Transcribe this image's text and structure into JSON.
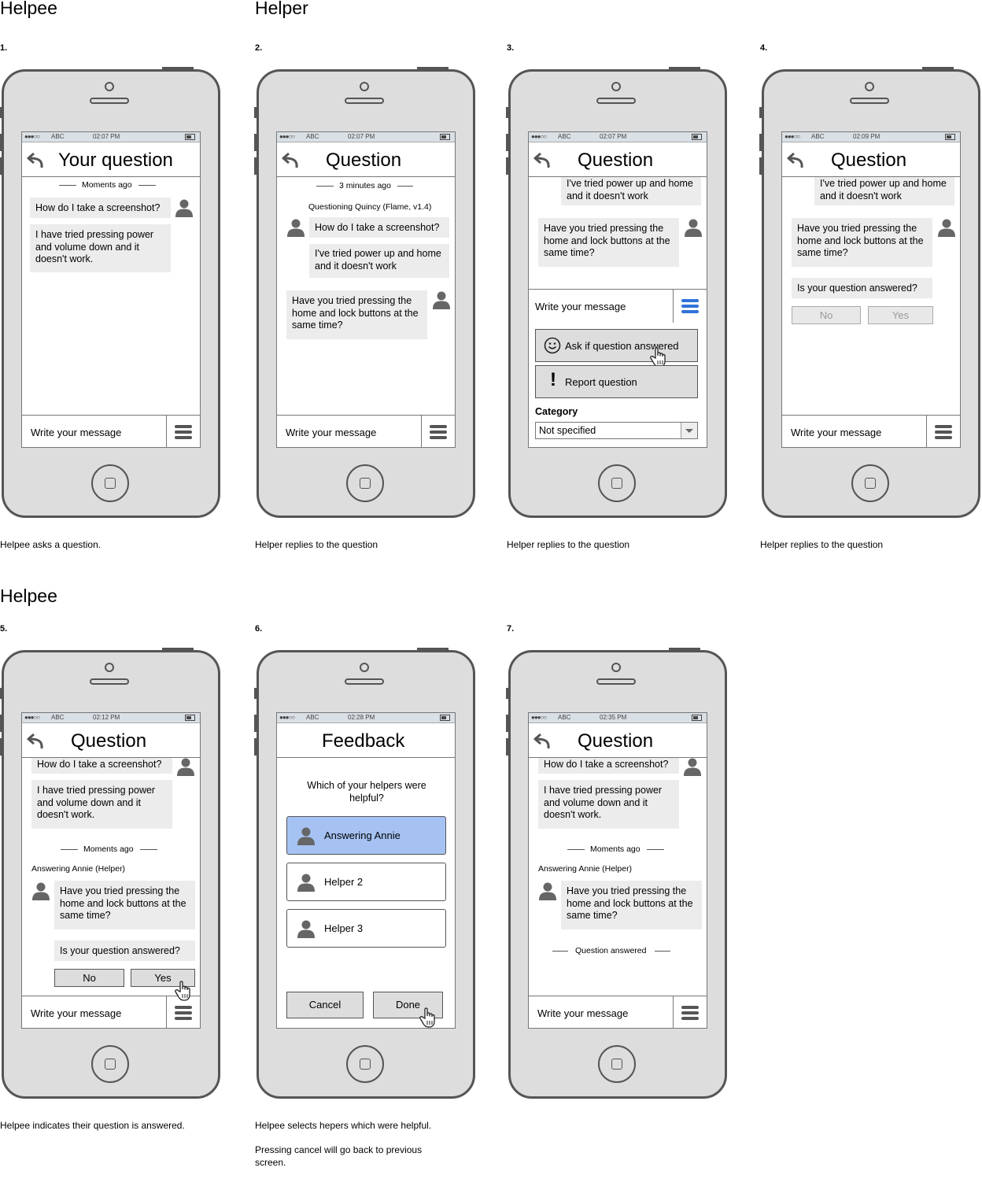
{
  "sections": {
    "helpee_top": "Helpee",
    "helper": "Helper",
    "helpee_bottom": "Helpee"
  },
  "captions": {
    "s1": "Helpee asks a question.",
    "s2": "Helper replies to the question",
    "s3": "Helper replies to the question",
    "s4": "Helper replies to the question",
    "s5": "Helpee indicates their question is answered.",
    "s6a": "Helpee selects hepers which were helpful.",
    "s6b": "Pressing cancel will go back to previous screen."
  },
  "status": {
    "signal": "●●●○○",
    "carrier": "ABC"
  },
  "input_placeholder": "Write your message",
  "icons": [
    "back-arrow-icon",
    "user-avatar-icon",
    "menu-icon",
    "smiley-icon",
    "exclamation-icon",
    "hand-cursor-icon",
    "dropdown-arrow-icon",
    "battery-icon",
    "home-button-icon"
  ],
  "accent_color": "#a5c2f2",
  "menu_active_color": "#2f73d8",
  "screens": [
    {
      "num": "1.",
      "time": "02:07 PM",
      "title": "Your question",
      "divider": "Moments ago",
      "msg1": "How do I take a screenshot?",
      "msg2": "I have tried pressing power and volume down and it doesn't work."
    },
    {
      "num": "2.",
      "time": "02:07 PM",
      "title": "Question",
      "divider": "3 minutes ago",
      "meta": "Questioning Quincy (Flame, v1.4)",
      "msg1": "How do I take a screenshot?",
      "msg2": "I've tried power up and home and it doesn't work",
      "reply": "Have you tried pressing the home and lock buttons at the same time?"
    },
    {
      "num": "3.",
      "time": "02:07 PM",
      "title": "Question",
      "msg2": "I've tried power up and home and it doesn't work",
      "reply": "Have you tried pressing the home and lock buttons at the same time?",
      "ask_btn": "Ask if question answered",
      "report_btn": "Report question",
      "category_label": "Category",
      "category_value": "Not specified"
    },
    {
      "num": "4.",
      "time": "02:09 PM",
      "title": "Question",
      "msg2": "I've tried power up and home and it doesn't work",
      "reply": "Have you tried pressing the home and lock buttons at the same time?",
      "ask": "Is your question answered?",
      "no": "No",
      "yes": "Yes"
    },
    {
      "num": "5.",
      "time": "02:12 PM",
      "title": "Question",
      "msg1": "How do I take a screenshot?",
      "msg2": "I have tried pressing power and volume down and it doesn't work.",
      "divider": "Moments ago",
      "meta": "Answering Annie (Helper)",
      "reply": "Have you tried pressing the home and lock buttons at the same time?",
      "ask": "Is your question answered?",
      "no": "No",
      "yes": "Yes"
    },
    {
      "num": "6.",
      "time": "02:28 PM",
      "title": "Feedback",
      "prompt": "Which of your helpers were helpful?",
      "helpers": [
        "Answering Annie",
        "Helper 2",
        "Helper 3"
      ],
      "cancel": "Cancel",
      "done": "Done"
    },
    {
      "num": "7.",
      "time": "02:35 PM",
      "title": "Question",
      "msg1": "How do I take a screenshot?",
      "msg2": "I have tried pressing power and volume down and it doesn't work.",
      "divider": "Moments ago",
      "meta": "Answering Annie (Helper)",
      "reply": "Have you tried pressing the home and lock buttons at the same time?",
      "answered": "Question answered"
    }
  ]
}
